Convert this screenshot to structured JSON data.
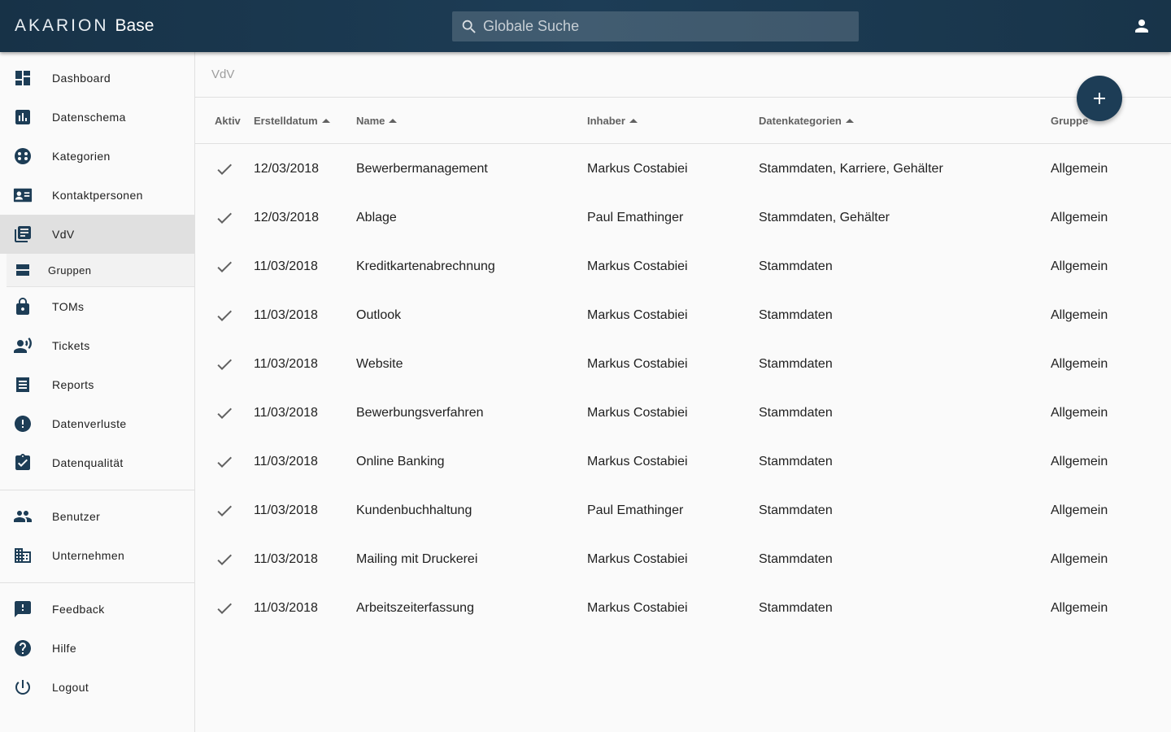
{
  "brand": {
    "light": "AKARION",
    "bold": "Base"
  },
  "search": {
    "placeholder": "Globale Suche",
    "icon": "search-icon"
  },
  "account": {
    "icon": "account-icon"
  },
  "sidebar": {
    "items": [
      {
        "label": "Dashboard",
        "icon": "dashboard-icon"
      },
      {
        "label": "Datenschema",
        "icon": "chart-icon"
      },
      {
        "label": "Kategorien",
        "icon": "categories-icon"
      },
      {
        "label": "Kontaktpersonen",
        "icon": "contact-card-icon"
      },
      {
        "label": "VdV",
        "icon": "library-books-icon",
        "active": true
      },
      {
        "label": "Gruppen",
        "icon": "group-list-icon",
        "sub": true
      },
      {
        "label": "TOMs",
        "icon": "lock-icon"
      },
      {
        "label": "Tickets",
        "icon": "record-voice-icon"
      },
      {
        "label": "Reports",
        "icon": "report-list-icon"
      },
      {
        "label": "Datenverluste",
        "icon": "error-icon"
      },
      {
        "label": "Datenqualität",
        "icon": "assignment-check-icon"
      },
      {
        "label": "Benutzer",
        "icon": "people-icon"
      },
      {
        "label": "Unternehmen",
        "icon": "business-icon"
      },
      {
        "label": "Feedback",
        "icon": "feedback-icon"
      },
      {
        "label": "Hilfe",
        "icon": "help-icon"
      },
      {
        "label": "Logout",
        "icon": "power-icon"
      }
    ]
  },
  "breadcrumb": "VdV",
  "table": {
    "headers": {
      "aktiv": "Aktiv",
      "date": "Erstelldatum",
      "name": "Name",
      "owner": "Inhaber",
      "categories": "Datenkategorien",
      "group": "Gruppe"
    },
    "rows": [
      {
        "date": "12/03/2018",
        "name": "Bewerbermanagement",
        "owner": "Markus Costabiei",
        "categories": "Stammdaten, Karriere, Gehälter",
        "group": "Allgemein"
      },
      {
        "date": "12/03/2018",
        "name": "Ablage",
        "owner": "Paul Emathinger",
        "categories": "Stammdaten, Gehälter",
        "group": "Allgemein"
      },
      {
        "date": "11/03/2018",
        "name": "Kreditkartenabrechnung",
        "owner": "Markus Costabiei",
        "categories": "Stammdaten",
        "group": "Allgemein"
      },
      {
        "date": "11/03/2018",
        "name": "Outlook",
        "owner": "Markus Costabiei",
        "categories": "Stammdaten",
        "group": "Allgemein"
      },
      {
        "date": "11/03/2018",
        "name": "Website",
        "owner": "Markus Costabiei",
        "categories": "Stammdaten",
        "group": "Allgemein"
      },
      {
        "date": "11/03/2018",
        "name": "Bewerbungsverfahren",
        "owner": "Markus Costabiei",
        "categories": "Stammdaten",
        "group": "Allgemein"
      },
      {
        "date": "11/03/2018",
        "name": "Online Banking",
        "owner": "Markus Costabiei",
        "categories": "Stammdaten",
        "group": "Allgemein"
      },
      {
        "date": "11/03/2018",
        "name": "Kundenbuchhaltung",
        "owner": "Paul Emathinger",
        "categories": "Stammdaten",
        "group": "Allgemein"
      },
      {
        "date": "11/03/2018",
        "name": "Mailing mit Druckerei",
        "owner": "Markus Costabiei",
        "categories": "Stammdaten",
        "group": "Allgemein"
      },
      {
        "date": "11/03/2018",
        "name": "Arbeitszeiterfassung",
        "owner": "Markus Costabiei",
        "categories": "Stammdaten",
        "group": "Allgemein"
      }
    ]
  },
  "fab": {
    "icon": "plus-icon"
  },
  "colors": {
    "primary": "#1d3d56",
    "active_nav": "#e0e0e0"
  }
}
